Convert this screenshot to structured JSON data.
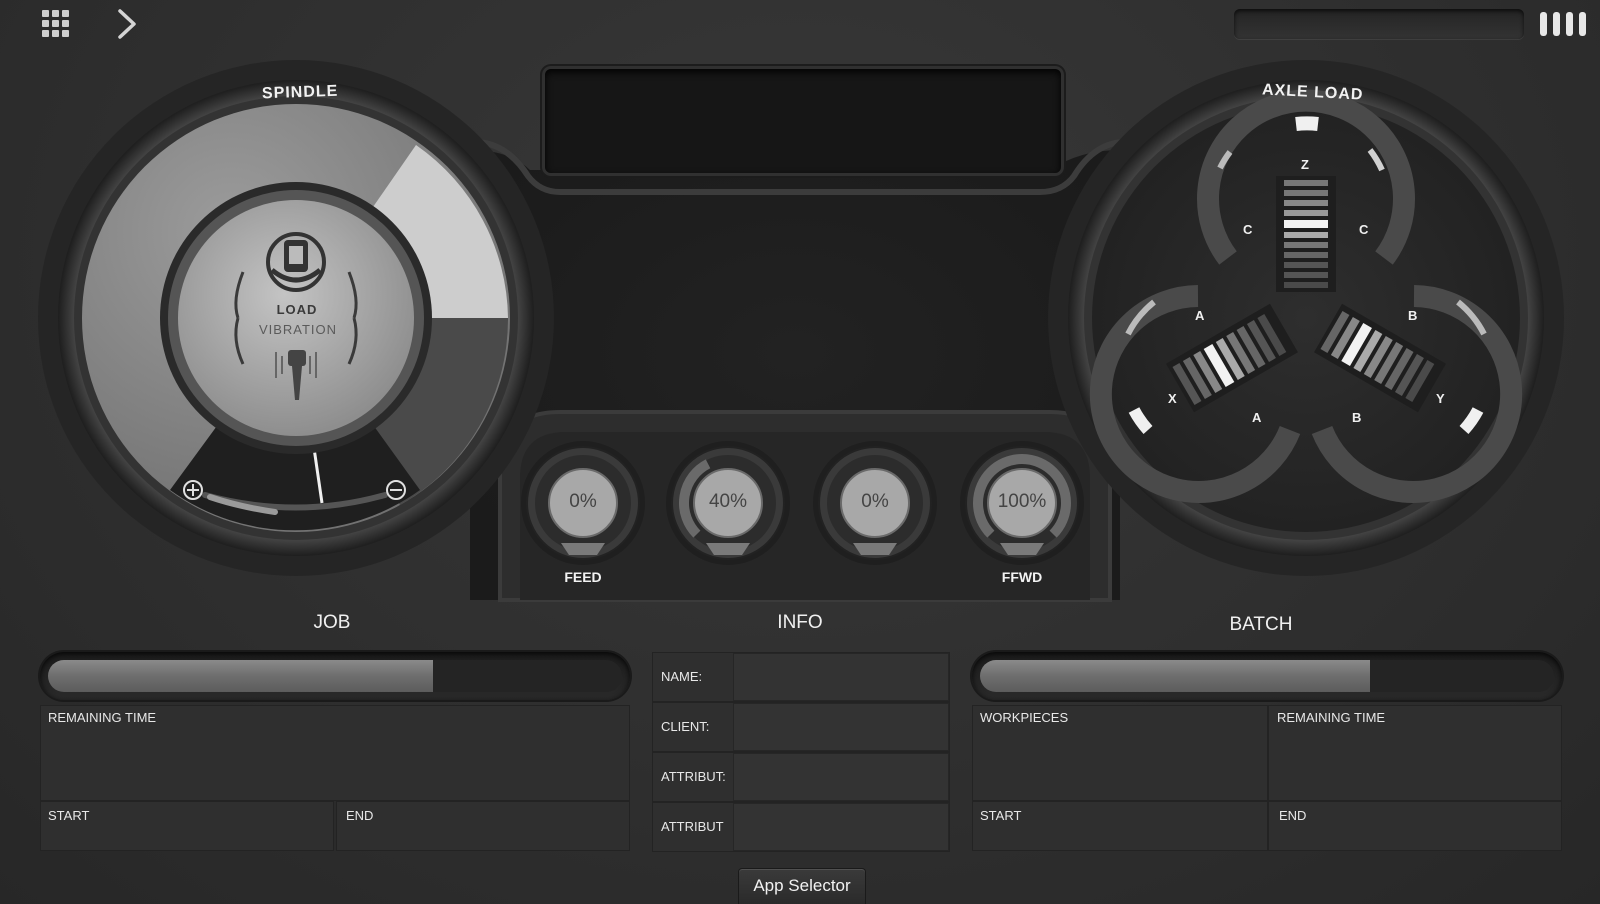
{
  "topbar": {
    "menu_icon": "grid-icon",
    "nav_icon": "chevron-right-icon",
    "status_icon": "battery-bars-icon"
  },
  "spindle": {
    "title": "SPINDLE",
    "hub_line1": "LOAD",
    "hub_line2": "VIBRATION",
    "plus_icon": "plus-circle-icon",
    "minus_icon": "minus-circle-icon"
  },
  "axle": {
    "title": "AXLE LOAD",
    "z_axis": {
      "letter": "Z",
      "left": "C",
      "right": "C"
    },
    "x_axis": {
      "letter": "X",
      "top": "A",
      "bottom": "A"
    },
    "y_axis": {
      "letter": "Y",
      "top": "B",
      "bottom": "B"
    }
  },
  "knobs": [
    {
      "value": "0%",
      "label": "FEED"
    },
    {
      "value": "40%",
      "label": ""
    },
    {
      "value": "0%",
      "label": ""
    },
    {
      "value": "100%",
      "label": "FFWD"
    }
  ],
  "job": {
    "title": "JOB",
    "progress": 0.67,
    "remaining_time_label": "REMAINING TIME",
    "start_label": "START",
    "end_label": "END"
  },
  "info": {
    "title": "INFO",
    "fields": [
      "NAME:",
      "CLIENT:",
      "ATTRIBUT:",
      "ATTRIBUT"
    ]
  },
  "batch": {
    "title": "BATCH",
    "progress": 0.68,
    "workpieces_label": "WORKPIECES",
    "remaining_time_label": "REMAINING TIME",
    "start_label": "START",
    "end_label": "END"
  },
  "app_selector_label": "App Selector"
}
